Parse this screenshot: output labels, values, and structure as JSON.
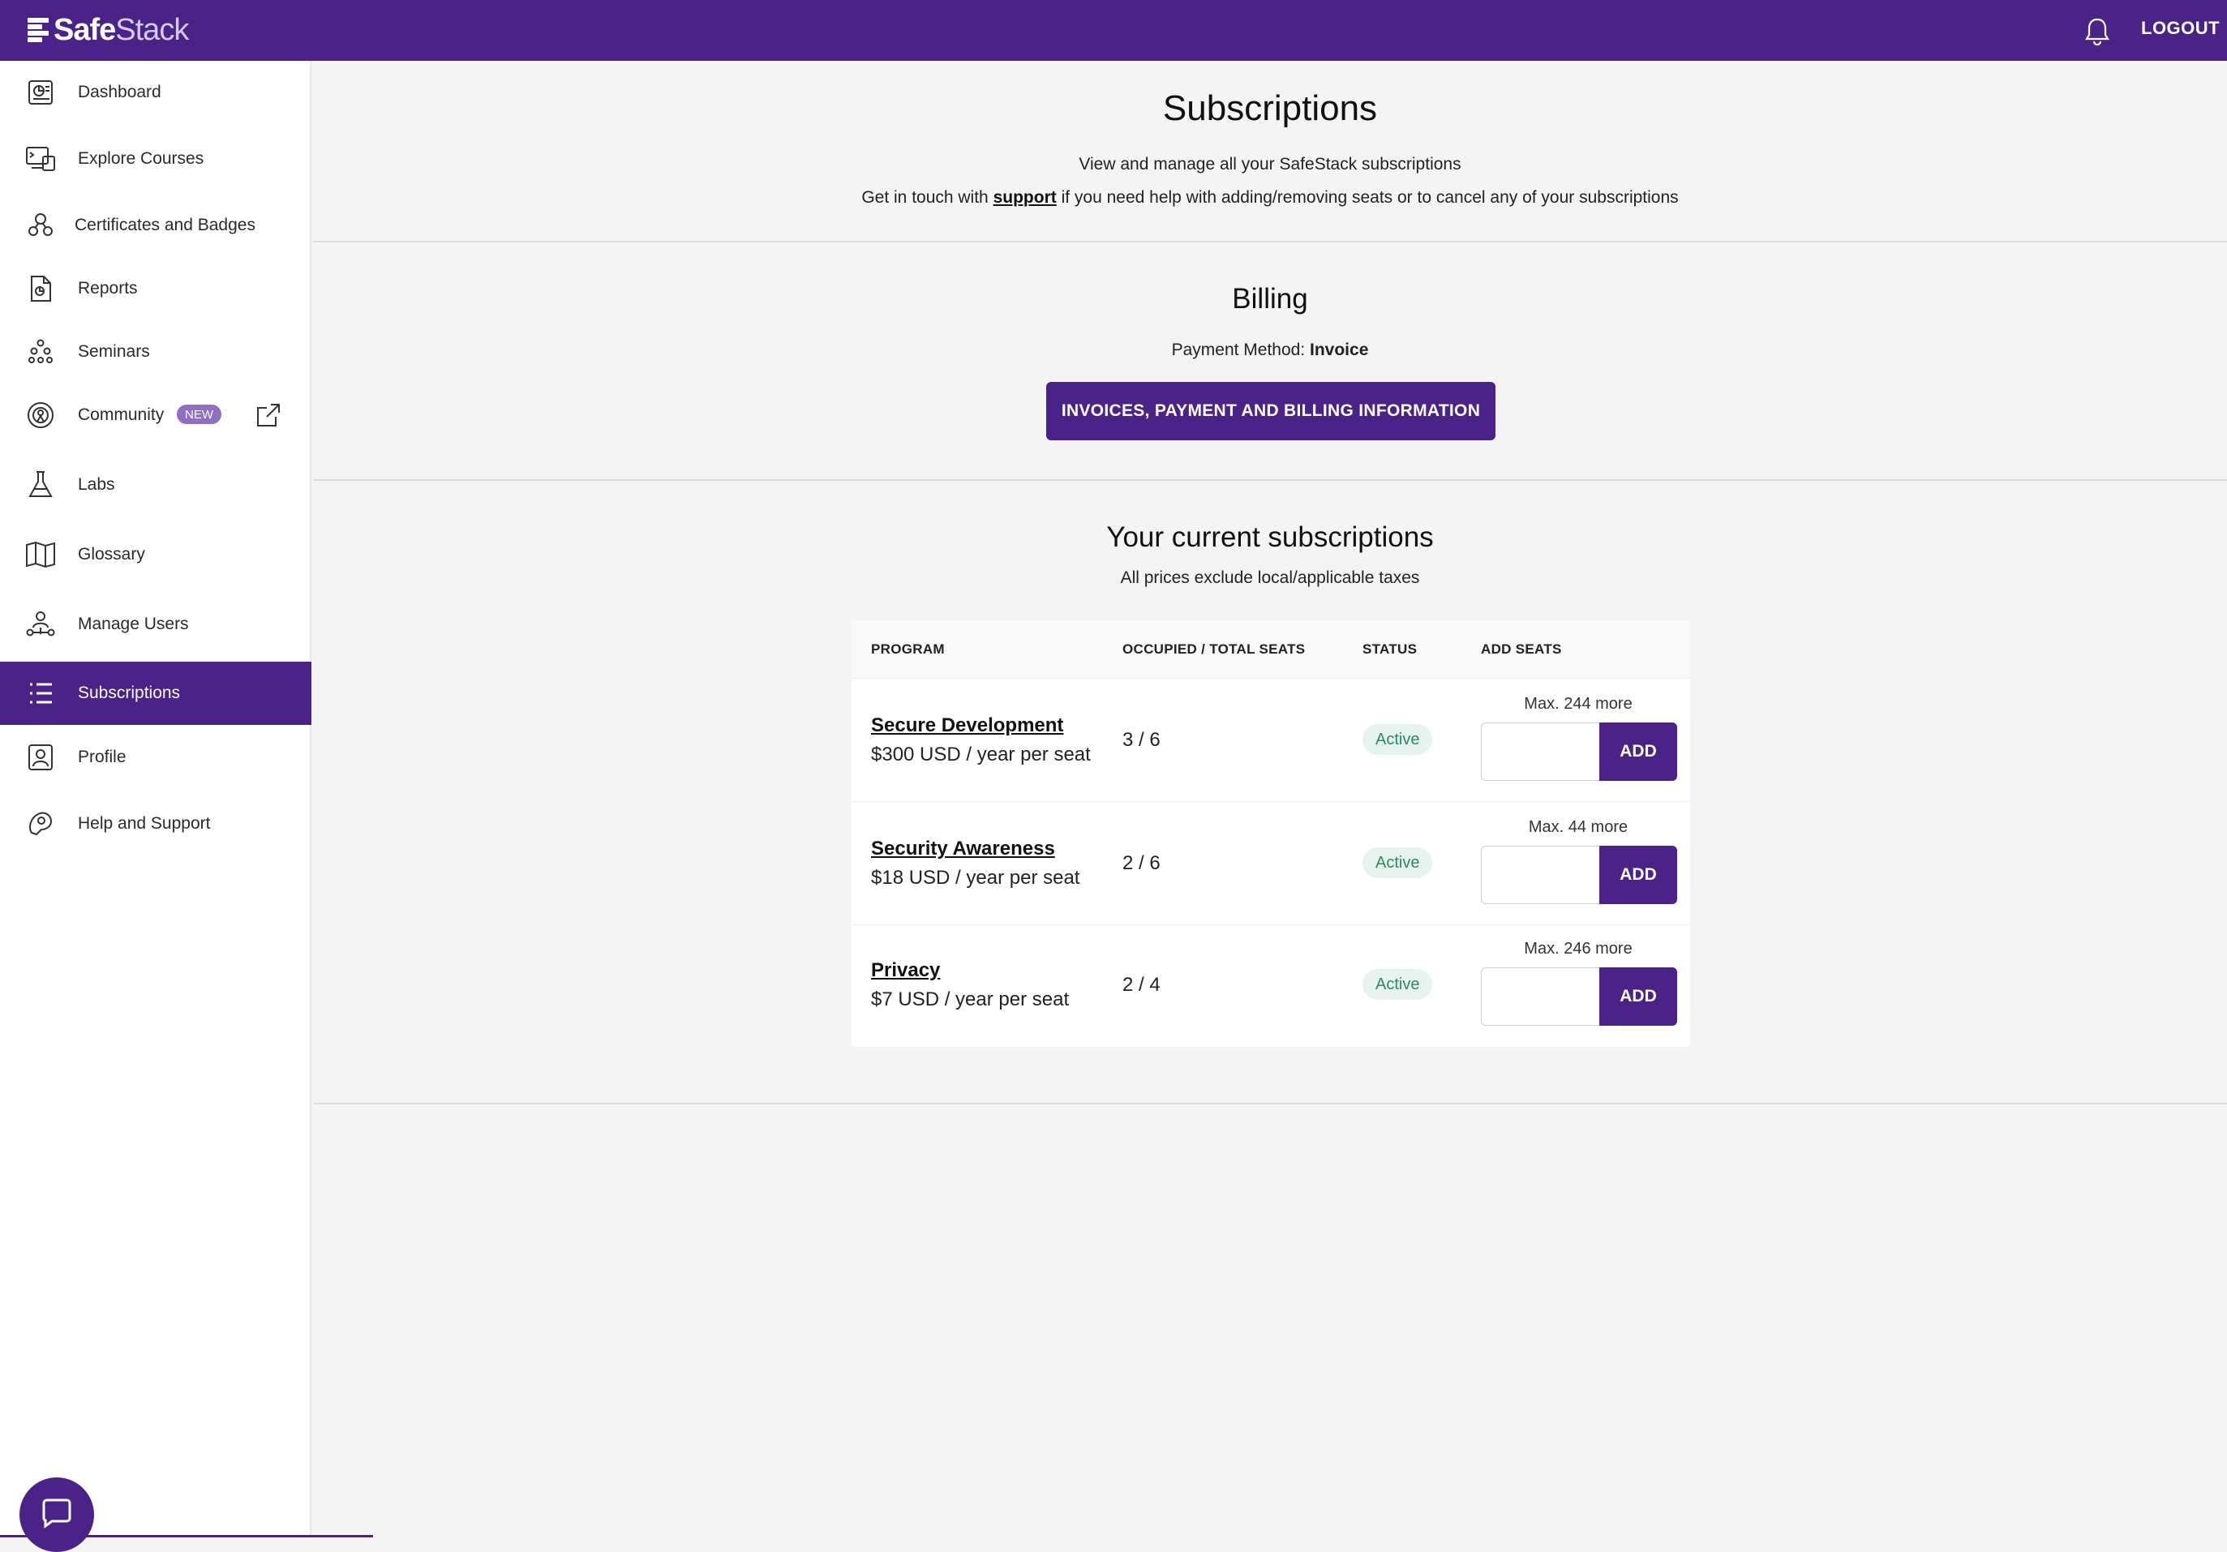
{
  "header": {
    "logo_text_safe": "Safe",
    "logo_text_stack": "Stack",
    "logout_label": "LOGOUT",
    "bell_icon": "bell-icon"
  },
  "sidebar": {
    "items": [
      {
        "label": "Dashboard",
        "icon": "dashboard-icon"
      },
      {
        "label": "Explore Courses",
        "icon": "courses-icon"
      },
      {
        "label": "Certificates and Badges",
        "icon": "certificates-icon"
      },
      {
        "label": "Reports",
        "icon": "reports-icon"
      },
      {
        "label": "Seminars",
        "icon": "seminars-icon"
      },
      {
        "label": "Community",
        "icon": "community-icon",
        "badge": "NEW"
      },
      {
        "label": "Labs",
        "icon": "flask-icon"
      },
      {
        "label": "Glossary",
        "icon": "book-icon"
      },
      {
        "label": "Manage Users",
        "icon": "users-icon"
      },
      {
        "label": "Subscriptions",
        "icon": "list-icon",
        "active": true
      },
      {
        "label": "Profile",
        "icon": "profile-icon"
      },
      {
        "label": "Help and Support",
        "icon": "help-icon"
      }
    ]
  },
  "page": {
    "title": "Subscriptions",
    "subtitle": "View and manage all your SafeStack subscriptions",
    "help_prefix": "Get in touch with ",
    "help_link": "support",
    "help_suffix": " if you need help with adding/removing seats or to cancel any of your subscriptions"
  },
  "billing": {
    "title": "Billing",
    "payment_label": "Payment Method: ",
    "payment_value": "Invoice",
    "button_label": "INVOICES, PAYMENT AND BILLING INFORMATION"
  },
  "subscriptions": {
    "title": "Your current subscriptions",
    "note": "All prices exclude local/applicable taxes",
    "columns": [
      "PROGRAM",
      "OCCUPIED / TOTAL SEATS",
      "STATUS",
      "ADD SEATS"
    ],
    "rows": [
      {
        "name": "Secure Development",
        "price": "$300 USD / year per seat",
        "seats": "3 / 6",
        "status": "Active",
        "max": "Max. 244 more",
        "add_label": "ADD",
        "input_value": ""
      },
      {
        "name": "Security Awareness",
        "price": "$18 USD / year per seat",
        "seats": "2 / 6",
        "status": "Active",
        "max": "Max. 44 more",
        "add_label": "ADD",
        "input_value": ""
      },
      {
        "name": "Privacy",
        "price": "$7 USD / year per seat",
        "seats": "2 / 4",
        "status": "Active",
        "max": "Max. 246 more",
        "add_label": "ADD",
        "input_value": ""
      }
    ]
  },
  "colors": {
    "brand": "#4b2388",
    "status_bg": "#e6f3ee",
    "status_text": "#2e8a63"
  }
}
